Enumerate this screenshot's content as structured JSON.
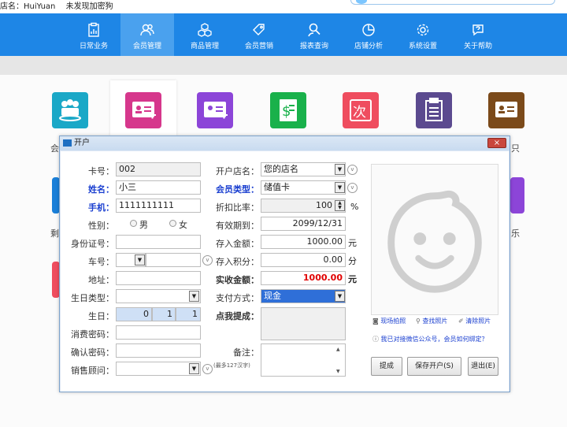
{
  "topbar": {
    "store_label": "店名：HuiYuan",
    "dog_status": "未发现加密狗"
  },
  "nav": {
    "items": [
      {
        "label": "日常业务",
        "icon": "clipboard-icon"
      },
      {
        "label": "会员管理",
        "icon": "members-icon"
      },
      {
        "label": "商品管理",
        "icon": "cubes-icon"
      },
      {
        "label": "会员营销",
        "icon": "tag-icon"
      },
      {
        "label": "报表查询",
        "icon": "search-person-icon"
      },
      {
        "label": "店铺分析",
        "icon": "pie-chart-icon"
      },
      {
        "label": "系统设置",
        "icon": "gear-icon"
      },
      {
        "label": "关于帮助",
        "icon": "help-chat-icon"
      }
    ]
  },
  "workspace": {
    "left_labels": [
      "会",
      "剩"
    ],
    "right_labels": [
      "只",
      "乐"
    ],
    "tile_colors": [
      "#1aa8c7",
      "#d6378c",
      "#8c45d8",
      "#19b14b",
      "#ef4d5f",
      "#5b4a8f",
      "#7b4a1a"
    ]
  },
  "dialog": {
    "title": "开户",
    "close_label": "×",
    "left": {
      "card_no_label": "卡号：",
      "card_no": "002",
      "name_label": "姓名：",
      "name": "小三",
      "phone_label": "手机：",
      "phone": "1111111111",
      "gender_label": "性别：",
      "gender_male": "男",
      "gender_female": "女",
      "idcard_label": "身份证号：",
      "plate_label": "车号：",
      "address_label": "地址：",
      "birthtype_label": "生日类型：",
      "birthday_label": "生日：",
      "birth_y": "0",
      "birth_m": "1",
      "birth_d": "1",
      "paypwd_label": "消费密码：",
      "confirm_label": "确认密码：",
      "advisor_label": "销售顾问："
    },
    "middle": {
      "store_label": "开户店名：",
      "store": "您的店名",
      "type_label": "会员类型：",
      "type": "储值卡",
      "discount_label": "折扣比率：",
      "discount": "100",
      "discount_unit": "%",
      "expire_label": "有效期到：",
      "expire": "2099/12/31",
      "deposit_label": "存入金额：",
      "deposit": "1000.00",
      "deposit_unit": "元",
      "points_label": "存入积分：",
      "points": "0.00",
      "points_unit": "分",
      "actual_label": "实收金额：",
      "actual": "1000.00",
      "actual_unit": "元",
      "paymethod_label": "支付方式：",
      "paymethod": "现金",
      "commission_label": "点我提成：",
      "remark_label": "备注：",
      "remark_hint": "(最多127汉字)"
    },
    "right": {
      "capture": "现场拍照",
      "find_photo": "查找照片",
      "clear_photo": "清除照片",
      "wechat_link": "我已对接微信公众号，会员如何绑定？",
      "btn_commission": "提成",
      "btn_save": "保存开户(S)",
      "btn_exit": "退出(E)"
    }
  }
}
